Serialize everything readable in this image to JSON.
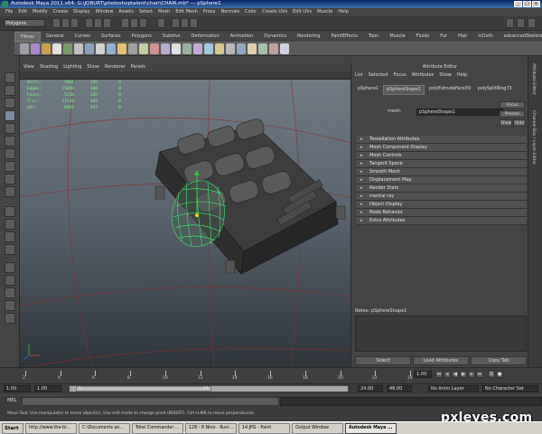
{
  "window": {
    "title": "Autodesk Maya 2011 x64: G:\\JOBURT\\photoshoptalent\\chair\\CHAIR.mb*  ---  pSphere1",
    "min_label": "_",
    "max_label": "□",
    "close_label": "×"
  },
  "menubar": [
    "File",
    "Edit",
    "Modify",
    "Create",
    "Display",
    "Window",
    "Assets",
    "Select",
    "Mesh",
    "Edit Mesh",
    "Proxy",
    "Normals",
    "Color",
    "Create UVs",
    "Edit UVs",
    "Muscle",
    "Help"
  ],
  "status_line": {
    "mode_selector": "Polygons"
  },
  "shelf_tabs": {
    "items": [
      "Filtres",
      "General",
      "Curves",
      "Surfaces",
      "Polygons",
      "Subdivs",
      "Deformation",
      "Animation",
      "Dynamics",
      "Rendering",
      "PaintEffects",
      "Toon",
      "Muscle",
      "Fluids",
      "Fur",
      "Hair",
      "nCloth",
      "advancedSkeleton"
    ],
    "active_index": 0
  },
  "viewport": {
    "menu": [
      "View",
      "Shading",
      "Lighting",
      "Show",
      "Renderer",
      "Panels"
    ],
    "hud": {
      "rows": [
        {
          "label": "Verts:",
          "a": "5861",
          "b": "246",
          "c": "0"
        },
        {
          "label": "Edges:",
          "a": "15050",
          "b": "460",
          "c": "0"
        },
        {
          "label": "Faces:",
          "a": "5310",
          "b": "245",
          "c": "0"
        },
        {
          "label": "Tris:",
          "a": "11530",
          "b": "469",
          "c": "0"
        },
        {
          "label": "UVs:",
          "a": "8961",
          "b": "267",
          "c": "0"
        }
      ]
    },
    "axis": {
      "x": "x",
      "y": "y",
      "z": "z"
    }
  },
  "attribute_editor": {
    "title": "Attribute Editor",
    "menu": [
      "List",
      "Selected",
      "Focus",
      "Attributes",
      "Show",
      "Help"
    ],
    "tabs": {
      "items": [
        "pSphere1",
        "pSphereShape1",
        "polyExtrudeFace39",
        "polySplitRing73"
      ],
      "active_index": 1
    },
    "mesh_label": "mesh:",
    "mesh_value": "pSphereShape1",
    "buttons": {
      "focus": "Focus",
      "presets": "Presets",
      "show": "Show",
      "hide": "Hide"
    },
    "sections": [
      "Tessellation Attributes",
      "Mesh Component Display",
      "Mesh Controls",
      "Tangent Space",
      "Smooth Mesh",
      "Displacement Map",
      "Render Stats",
      "mental ray",
      "Object Display",
      "Node Behavior",
      "Extra Attributes"
    ],
    "notes_label": "Notes:  pSphereShape1",
    "bottom_buttons": [
      "Select",
      "Load Attributes",
      "Copy Tab"
    ]
  },
  "right_tabs": [
    "Attribute Editor",
    "Channel Box / Layer Editor"
  ],
  "time_slider": {
    "ticks": [
      "2",
      "4",
      "6",
      "8",
      "10",
      "12",
      "14",
      "16",
      "18",
      "20",
      "22",
      "24"
    ],
    "current_frame": "1.00"
  },
  "range_slider": {
    "start": "1.00",
    "inner_start": "1.00",
    "thumb_label_start": "1",
    "thumb_label_end": "24",
    "end": "24.00",
    "outer_end": "48.00",
    "anim_layer": "No Anim Layer",
    "char_set": "No Character Set"
  },
  "mel": {
    "label": "MEL"
  },
  "help_line": "Move Tool: Use manipulator to move object(s). Use edit mode to change pivot (INSERT). Ctrl+LMB to move perpendicular.",
  "taskbar": {
    "start": "Start",
    "items": [
      "http://www.the-bl...",
      "C:\\Documents an...",
      "Total Commander ...",
      "128 - 8 Nino - Runi...",
      "14.JPG - Paint",
      "Output Window",
      "Autodesk Maya ..."
    ],
    "active_index": 6
  },
  "watermark": "pxleyes.com"
}
